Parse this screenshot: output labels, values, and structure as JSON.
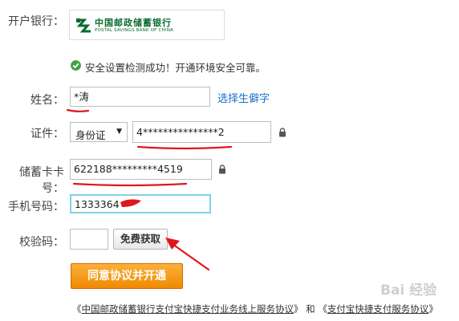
{
  "form": {
    "bank_label": "开户银行：",
    "bank_name_cn": "中国邮政储蓄银行",
    "bank_name_en": "POSTAL SAVINGS BANK OF CHINA",
    "security_message": "安全设置检测成功！开通环境安全可靠。",
    "name_label": "姓名：",
    "name_value": "*涛",
    "rare_char_link": "选择生僻字",
    "id_label": "证件：",
    "id_type": "身份证",
    "id_value": "4***************2",
    "card_label": "储蓄卡卡号：",
    "card_value": "622188*********4519",
    "phone_label": "手机号码：",
    "phone_value": "1333364",
    "code_label": "校验码：",
    "code_value": "",
    "get_code_button": "免费获取",
    "submit_button": "同意协议并开通"
  },
  "footer": {
    "quote_open_1": "《",
    "agreement_1": "中国邮政储蓄银行支付宝快捷支付业务线上服务协议",
    "quote_close_1": "》",
    "and": " 和 ",
    "quote_open_2": "《",
    "agreement_2": "支付宝快捷支付服务协议",
    "quote_close_2": "》"
  },
  "watermark": "Bai 经验",
  "colors": {
    "accent_orange": "#f08a00",
    "link_blue": "#1a6fc8",
    "annotation_red": "#e0171b",
    "success_green": "#3fa443",
    "bank_green": "#0a6b2f"
  },
  "icons": [
    "check-circle-icon",
    "lock-icon",
    "chevron-down-icon",
    "bank-logo-icon"
  ]
}
